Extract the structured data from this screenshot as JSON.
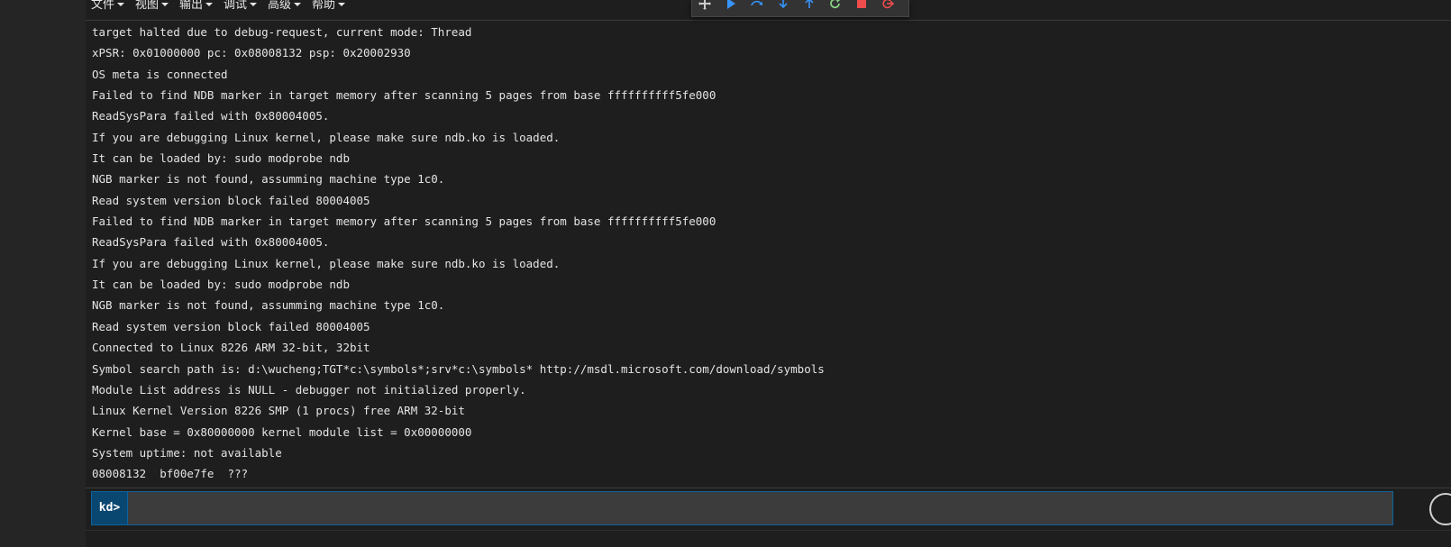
{
  "menu": {
    "items": [
      {
        "label": "文件"
      },
      {
        "label": "视图"
      },
      {
        "label": "输出"
      },
      {
        "label": "调试"
      },
      {
        "label": "高级"
      },
      {
        "label": "帮助"
      }
    ]
  },
  "toolbar": {
    "buttons": [
      {
        "icon": "move-handle-icon",
        "color": "#cccccc"
      },
      {
        "icon": "continue-icon",
        "color": "#3794ff"
      },
      {
        "icon": "step-over-icon",
        "color": "#3794ff"
      },
      {
        "icon": "step-into-icon",
        "color": "#3794ff"
      },
      {
        "icon": "step-out-icon",
        "color": "#3794ff"
      },
      {
        "icon": "restart-icon",
        "color": "#89d185"
      },
      {
        "icon": "stop-icon",
        "color": "#f14c4c"
      },
      {
        "icon": "disconnect-icon",
        "color": "#f14c4c"
      }
    ]
  },
  "output": {
    "lines": [
      "target halted due to debug-request, current mode: Thread",
      "xPSR: 0x01000000 pc: 0x08008132 psp: 0x20002930",
      "OS meta is connected",
      "Failed to find NDB marker in target memory after scanning 5 pages from base ffffffffff5fe000",
      "ReadSysPara failed with 0x80004005.",
      "If you are debugging Linux kernel, please make sure ndb.ko is loaded.",
      "It can be loaded by: sudo modprobe ndb",
      "NGB marker is not found, assumming machine type 1c0.",
      "Read system version block failed 80004005",
      "Failed to find NDB marker in target memory after scanning 5 pages from base ffffffffff5fe000",
      "ReadSysPara failed with 0x80004005.",
      "If you are debugging Linux kernel, please make sure ndb.ko is loaded.",
      "It can be loaded by: sudo modprobe ndb",
      "NGB marker is not found, assumming machine type 1c0.",
      "Read system version block failed 80004005",
      "Connected to Linux 8226 ARM 32-bit, 32bit",
      "Symbol search path is: d:\\wucheng;TGT*c:\\symbols*;srv*c:\\symbols* http://msdl.microsoft.com/download/symbols",
      "Module List address is NULL - debugger not initialized properly.",
      "Linux Kernel Version 8226 SMP (1 procs) free ARM 32-bit",
      "Kernel base = 0x80000000 kernel module list = 0x00000000",
      "System uptime: not available",
      "08008132  bf00e7fe  ???"
    ]
  },
  "command": {
    "prompt": "kd>",
    "value": ""
  },
  "colors": {
    "background": "#1e1e1e",
    "prompt_bg": "#094771",
    "input_border": "#0e639c"
  }
}
